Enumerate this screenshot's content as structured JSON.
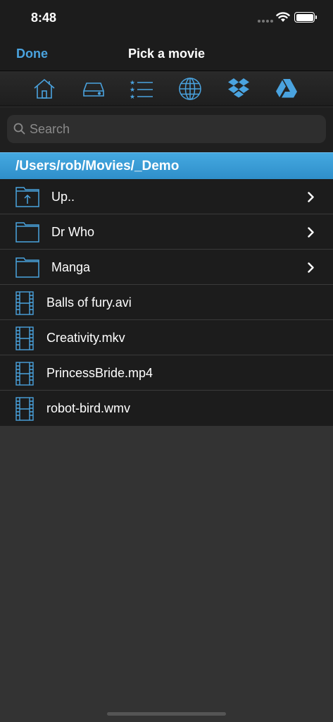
{
  "status_bar": {
    "time": "8:48"
  },
  "navbar": {
    "done_label": "Done",
    "title": "Pick a movie"
  },
  "toolbar": {
    "icons": [
      "home-icon",
      "hard-drive-icon",
      "starred-list-icon",
      "globe-icon",
      "dropbox-icon",
      "google-drive-icon"
    ]
  },
  "search": {
    "placeholder": "Search",
    "value": ""
  },
  "path": "/Users/rob/Movies/_Demo",
  "folders": [
    {
      "name": "Up..",
      "icon": "folder-up-icon"
    },
    {
      "name": "Dr Who",
      "icon": "folder-icon"
    },
    {
      "name": "Manga",
      "icon": "folder-icon"
    }
  ],
  "files": [
    {
      "name": "Balls of fury.avi",
      "icon": "film-icon"
    },
    {
      "name": "Creativity.mkv",
      "icon": "film-icon"
    },
    {
      "name": "PrincessBride.mp4",
      "icon": "film-icon"
    },
    {
      "name": "robot-bird.wmv",
      "icon": "film-icon"
    }
  ],
  "colors": {
    "accent": "#4aa3df",
    "path_header": "#3a9ed8",
    "background": "#333333",
    "row": "#1c1c1c"
  }
}
